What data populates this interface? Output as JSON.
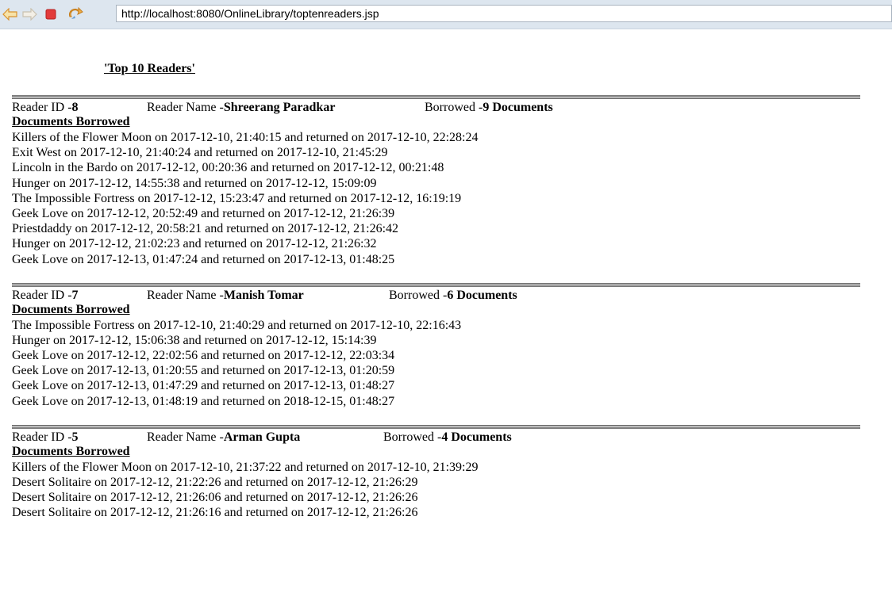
{
  "browser": {
    "url": "http://localhost:8080/OnlineLibrary/toptenreaders.jsp",
    "icons": [
      "back-arrow-icon",
      "forward-arrow-icon",
      "stop-icon",
      "refresh-icon"
    ],
    "colors": {
      "toolbar": "#dde6ef",
      "back": "#e8a23a",
      "stop": "#e23b3b",
      "refresh": "#e3a33b"
    }
  },
  "page": {
    "title": "'Top 10 Readers'",
    "labels": {
      "reader_id": "Reader ID - ",
      "reader_name": "Reader Name - ",
      "borrowed": "Borrowed - ",
      "documents_borrowed": "Documents Borrowed"
    },
    "readers": [
      {
        "id": "8",
        "name": "Shreerang Paradkar",
        "borrowed": "9 Documents",
        "documents": [
          "Killers of the Flower Moon on 2017-12-10, 21:40:15 and returned on 2017-12-10, 22:28:24",
          "Exit West on 2017-12-10, 21:40:24 and returned on 2017-12-10, 21:45:29",
          "Lincoln in the Bardo on 2017-12-12, 00:20:36 and returned on 2017-12-12, 00:21:48",
          "Hunger on 2017-12-12, 14:55:38 and returned on 2017-12-12, 15:09:09",
          "The Impossible Fortress on 2017-12-12, 15:23:47 and returned on 2017-12-12, 16:19:19",
          "Geek Love on 2017-12-12, 20:52:49 and returned on 2017-12-12, 21:26:39",
          "Priestdaddy on 2017-12-12, 20:58:21 and returned on 2017-12-12, 21:26:42",
          "Hunger on 2017-12-12, 21:02:23 and returned on 2017-12-12, 21:26:32",
          "Geek Love on 2017-12-13, 01:47:24 and returned on 2017-12-13, 01:48:25"
        ]
      },
      {
        "id": "7",
        "name": "Manish Tomar",
        "borrowed": "6 Documents",
        "documents": [
          "The Impossible Fortress on 2017-12-10, 21:40:29 and returned on 2017-12-10, 22:16:43",
          "Hunger on 2017-12-12, 15:06:38 and returned on 2017-12-12, 15:14:39",
          "Geek Love on 2017-12-12, 22:02:56 and returned on 2017-12-12, 22:03:34",
          "Geek Love on 2017-12-13, 01:20:55 and returned on 2017-12-13, 01:20:59",
          "Geek Love on 2017-12-13, 01:47:29 and returned on 2017-12-13, 01:48:27",
          "Geek Love on 2017-12-13, 01:48:19 and returned on 2018-12-15, 01:48:27"
        ]
      },
      {
        "id": "5",
        "name": "Arman Gupta",
        "borrowed": "4 Documents",
        "documents": [
          "Killers of the Flower Moon on 2017-12-10, 21:37:22 and returned on 2017-12-10, 21:39:29",
          "Desert Solitaire on 2017-12-12, 21:22:26 and returned on 2017-12-12, 21:26:29",
          "Desert Solitaire on 2017-12-12, 21:26:06 and returned on 2017-12-12, 21:26:26",
          "Desert Solitaire on 2017-12-12, 21:26:16 and returned on 2017-12-12, 21:26:26"
        ]
      }
    ]
  }
}
